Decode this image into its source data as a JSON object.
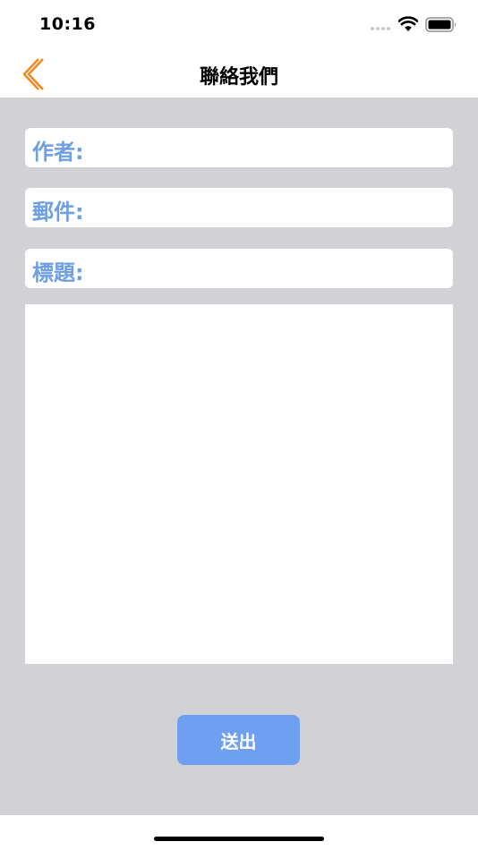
{
  "status_bar": {
    "time": "10:16"
  },
  "nav": {
    "title": "聯絡我們",
    "back_icon": "chevron-left-icon"
  },
  "form": {
    "author_label": "作者:",
    "email_label": "郵件:",
    "subject_label": "標題:",
    "author_value": "",
    "email_value": "",
    "subject_value": "",
    "message_value": "",
    "submit_label": "送出"
  },
  "colors": {
    "accent": "#f08a24",
    "label": "#6e9ee3",
    "button": "#6e9ff0",
    "background": "#d2d1d6"
  }
}
